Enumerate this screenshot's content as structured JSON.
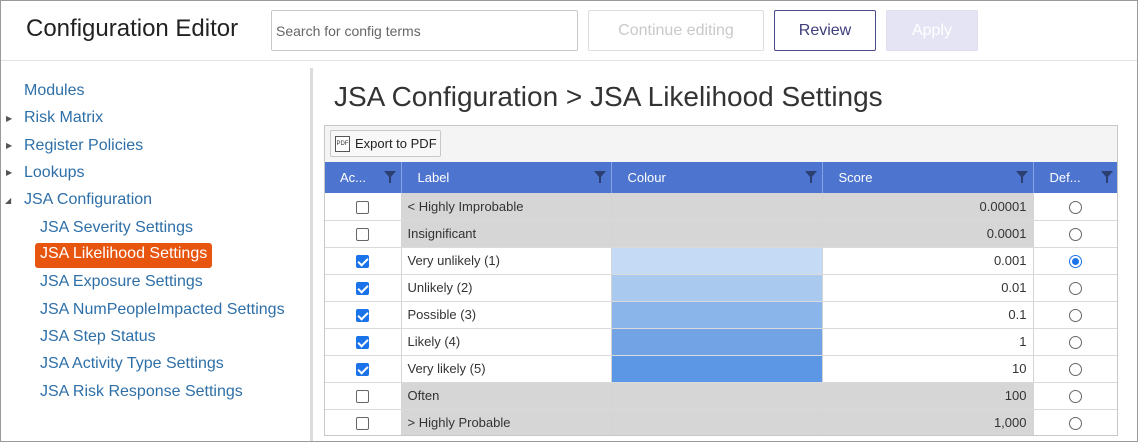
{
  "app": {
    "title": "Configuration Editor"
  },
  "search": {
    "placeholder": "Search for config terms",
    "value": ""
  },
  "header_buttons": {
    "continue_label": "Continue editing",
    "review_label": "Review",
    "apply_label": "Apply"
  },
  "sidebar": {
    "items": [
      {
        "label": "Modules",
        "expandable": false,
        "expanded": false
      },
      {
        "label": "Risk Matrix",
        "expandable": true,
        "expanded": false
      },
      {
        "label": "Register Policies",
        "expandable": true,
        "expanded": false
      },
      {
        "label": "Lookups",
        "expandable": true,
        "expanded": false
      },
      {
        "label": "JSA Configuration",
        "expandable": true,
        "expanded": true
      }
    ],
    "children": [
      {
        "label": "JSA Severity Settings",
        "selected": false
      },
      {
        "label": "JSA Likelihood Settings",
        "selected": true
      },
      {
        "label": "JSA Exposure Settings",
        "selected": false
      },
      {
        "label": "JSA NumPeopleImpacted Settings",
        "selected": false
      },
      {
        "label": "JSA Step Status",
        "selected": false
      },
      {
        "label": "JSA Activity Type Settings",
        "selected": false
      },
      {
        "label": "JSA Risk Response Settings",
        "selected": false
      }
    ]
  },
  "main": {
    "title": "JSA Configuration > JSA Likelihood Settings",
    "export_label": "Export to PDF",
    "columns": {
      "active": "Ac...",
      "label": "Label",
      "colour": "Colour",
      "score": "Score",
      "default": "Def..."
    },
    "rows": [
      {
        "active": false,
        "label": "< Highly Improbable",
        "colour": "",
        "score": "0.00001",
        "default": false
      },
      {
        "active": false,
        "label": "Insignificant",
        "colour": "",
        "score": "0.0001",
        "default": false
      },
      {
        "active": true,
        "label": "Very unlikely (1)",
        "colour": "#c5dbf5",
        "score": "0.001",
        "default": true
      },
      {
        "active": true,
        "label": "Unlikely (2)",
        "colour": "#a9c9ef",
        "score": "0.01",
        "default": false
      },
      {
        "active": true,
        "label": "Possible (3)",
        "colour": "#8ab5ea",
        "score": "0.1",
        "default": false
      },
      {
        "active": true,
        "label": "Likely (4)",
        "colour": "#72a3e4",
        "score": "1",
        "default": false
      },
      {
        "active": true,
        "label": "Very likely (5)",
        "colour": "#5c97e6",
        "score": "10",
        "default": false
      },
      {
        "active": false,
        "label": "Often",
        "colour": "",
        "score": "100",
        "default": false
      },
      {
        "active": false,
        "label": "> Highly Probable",
        "colour": "",
        "score": "1,000",
        "default": false
      }
    ]
  },
  "colors": {
    "accent": "#e8550e",
    "header_blue": "#4d74ce",
    "link": "#2e6fa8",
    "check_blue": "#1a73e8"
  }
}
